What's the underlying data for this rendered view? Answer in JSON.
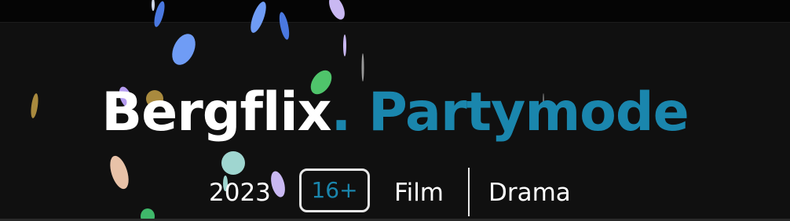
{
  "title": {
    "brand": "Bergflix",
    "separator": ".",
    "mode": "Partymode"
  },
  "meta": {
    "year": "2023",
    "age_rating": "16+",
    "genres": [
      "Film",
      "Drama"
    ]
  },
  "colors": {
    "background": "#101010",
    "accent": "#1a86ad",
    "text": "#ffffff"
  },
  "decoration": {
    "effect": "confetti",
    "confetti_colors": [
      "#6f9cf5",
      "#4a78e0",
      "#c9b8f2",
      "#4fc46b",
      "#a98a3e",
      "#e8c2a8",
      "#9fd6d0",
      "#b59cf0",
      "#3fb86a"
    ]
  }
}
